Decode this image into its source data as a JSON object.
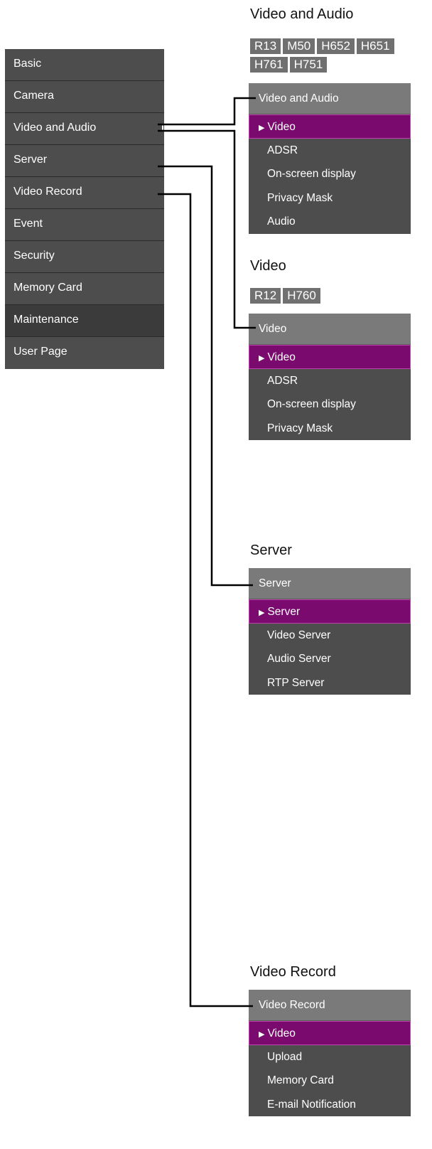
{
  "sidebar": {
    "items": [
      {
        "label": "Basic"
      },
      {
        "label": "Camera"
      },
      {
        "label": "Video and Audio"
      },
      {
        "label": "Server"
      },
      {
        "label": "Video Record"
      },
      {
        "label": "Event"
      },
      {
        "label": "Security"
      },
      {
        "label": "Memory Card"
      },
      {
        "label": "Maintenance"
      },
      {
        "label": "User Page"
      }
    ]
  },
  "sections": {
    "video_and_audio": {
      "title": "Video and Audio",
      "badges": [
        "R13",
        "M50",
        "H652",
        "H651",
        "H761",
        "H751"
      ],
      "header": "Video and Audio",
      "items": [
        "Video",
        "ADSR",
        "On-screen display",
        "Privacy Mask",
        "Audio"
      ]
    },
    "video": {
      "title": "Video",
      "badges": [
        "R12",
        "H760"
      ],
      "header": "Video",
      "items": [
        "Video",
        "ADSR",
        "On-screen display",
        "Privacy Mask"
      ]
    },
    "server": {
      "title": "Server",
      "header": "Server",
      "items": [
        "Server",
        "Video Server",
        "Audio Server",
        "RTP Server"
      ]
    },
    "video_record": {
      "title": "Video Record",
      "header": "Video Record",
      "items": [
        "Video",
        "Upload",
        "Memory Card",
        "E-mail Notification"
      ]
    }
  },
  "colors": {
    "menu_bg": "#4d4d4d",
    "header_bg": "#7a7a7a",
    "active_bg": "#7a0a6e",
    "badge_bg": "#707070"
  }
}
